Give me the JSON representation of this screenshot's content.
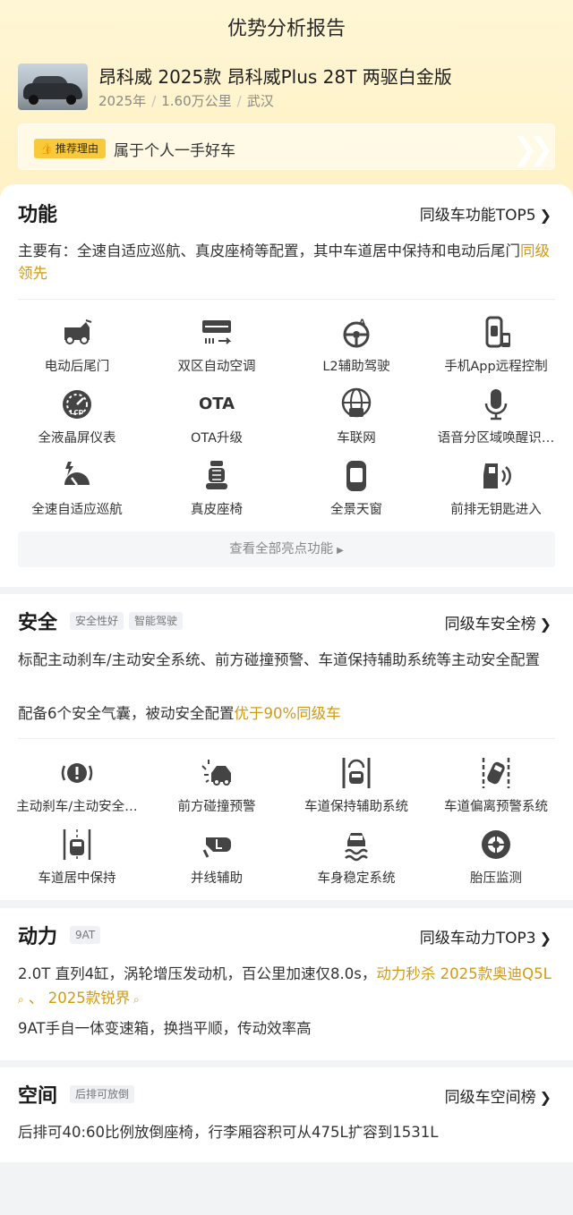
{
  "page": {
    "title": "优势分析报告"
  },
  "car": {
    "name": "昂科威 2025款 昂科威Plus 28T 两驱白金版",
    "year": "2025年",
    "mileage": "1.60万公里",
    "city": "武汉"
  },
  "reason": {
    "badge": "推荐理由",
    "text": "属于个人一手好车"
  },
  "colors": {
    "accent": "#f7c93b",
    "highlight": "#d19a16"
  },
  "function": {
    "title": "功能",
    "link": "同级车功能TOP5",
    "desc_prefix": "主要有：全速自适应巡航、真皮座椅等配置，其中车道居中保持和电动后尾门",
    "desc_hl": "同级领先",
    "items": [
      {
        "label": "电动后尾门",
        "icon": "tailgate-icon"
      },
      {
        "label": "双区自动空调",
        "icon": "ac-icon"
      },
      {
        "label": "L2辅助驾驶",
        "icon": "steering-assist-icon"
      },
      {
        "label": "手机App远程控制",
        "icon": "phone-car-icon"
      },
      {
        "label": "全液晶屏仪表",
        "icon": "lcd-gauge-icon"
      },
      {
        "label": "OTA升级",
        "icon": "ota-icon",
        "glyph": "OTA"
      },
      {
        "label": "车联网",
        "icon": "connected-car-icon"
      },
      {
        "label": "语音分区域唤醒识…",
        "icon": "microphone-icon"
      },
      {
        "label": "全速自适应巡航",
        "icon": "cruise-icon"
      },
      {
        "label": "真皮座椅",
        "icon": "seat-icon"
      },
      {
        "label": "全景天窗",
        "icon": "sunroof-icon"
      },
      {
        "label": "前排无钥匙进入",
        "icon": "keyless-door-icon"
      }
    ],
    "see_all": "查看全部亮点功能"
  },
  "safety": {
    "title": "安全",
    "tags": [
      "安全性好",
      "智能驾驶"
    ],
    "link": "同级车安全榜",
    "desc1": "标配主动刹车/主动安全系统、前方碰撞预警、车道保持辅助系统等主动安全配置",
    "desc2_prefix": "配备6个安全气囊，被动安全配置",
    "desc2_hl": "优于90%同级车",
    "items": [
      {
        "label": "主动刹车/主动安全…",
        "icon": "brake-warning-icon"
      },
      {
        "label": "前方碰撞预警",
        "icon": "collision-warning-icon"
      },
      {
        "label": "车道保持辅助系统",
        "icon": "lane-keep-icon"
      },
      {
        "label": "车道偏离预警系统",
        "icon": "lane-departure-icon"
      },
      {
        "label": "车道居中保持",
        "icon": "lane-center-icon"
      },
      {
        "label": "并线辅助",
        "icon": "mirror-assist-icon"
      },
      {
        "label": "车身稳定系统",
        "icon": "stability-icon"
      },
      {
        "label": "胎压监测",
        "icon": "tire-pressure-icon"
      }
    ]
  },
  "power": {
    "title": "动力",
    "tag": "9AT",
    "link": "同级车动力TOP3",
    "desc1_prefix": "2.0T 直列4缸，涡轮增压发动机，百公里加速仅8.0s，",
    "desc1_hl1": "动力秒杀 2025款奥迪Q5L",
    "desc1_sep": " 、 ",
    "desc1_hl2": "2025款锐界",
    "desc2": "9AT手自一体变速箱，换挡平顺，传动效率高"
  },
  "space": {
    "title": "空间",
    "tag": "后排可放倒",
    "link": "同级车空间榜",
    "desc": "后排可40:60比例放倒座椅，行李厢容积可从475L扩容到1531L"
  }
}
